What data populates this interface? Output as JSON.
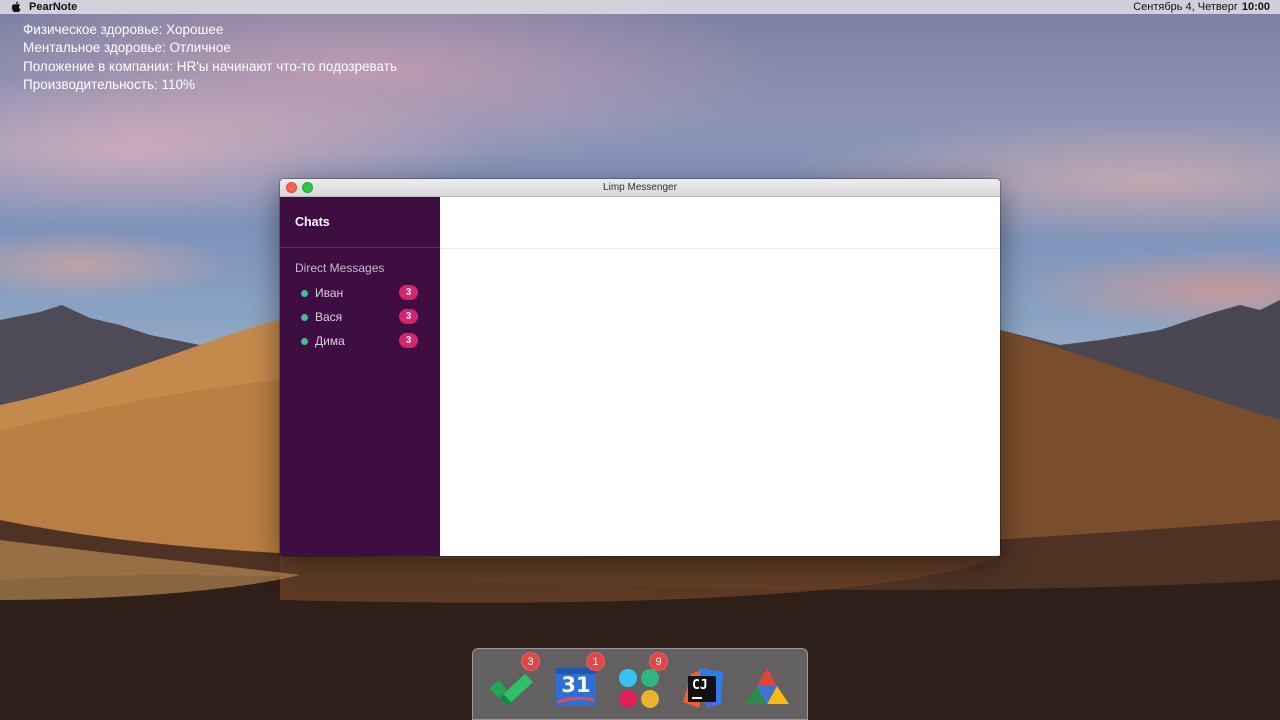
{
  "menubar": {
    "app_name": "PearNote",
    "date": "Сентябрь 4, Четверг",
    "time": "10:00"
  },
  "status_lines": {
    "physical": "Физическое здоровье: Хорошее",
    "mental": "Ментальное здоровье: Отличное",
    "company": "Положение в компании: HR'ы начинают что-то подозревать",
    "productivity": "Производительность: 110%"
  },
  "window": {
    "title": "Limp Messenger",
    "sidebar": {
      "header": "Chats",
      "section_title": "Direct Messages",
      "items": [
        {
          "label": "Иван",
          "badge": "3"
        },
        {
          "label": "Вася",
          "badge": "3"
        },
        {
          "label": "Дима",
          "badge": "3"
        }
      ]
    }
  },
  "dock": {
    "apps": [
      {
        "icon": "checkmark-tasks-icon",
        "badge": "3"
      },
      {
        "icon": "calendar-icon",
        "label": "31",
        "badge": "1"
      },
      {
        "icon": "dots-chat-icon",
        "badge": "9"
      },
      {
        "icon": "cj-ide-icon",
        "label": "CJ"
      },
      {
        "icon": "triangle-drive-icon"
      }
    ]
  },
  "colors": {
    "sidebar_bg": "#3e0e42",
    "badge": "#d8246c",
    "presence": "#3fbf8e",
    "dock_badge": "#e64545"
  }
}
